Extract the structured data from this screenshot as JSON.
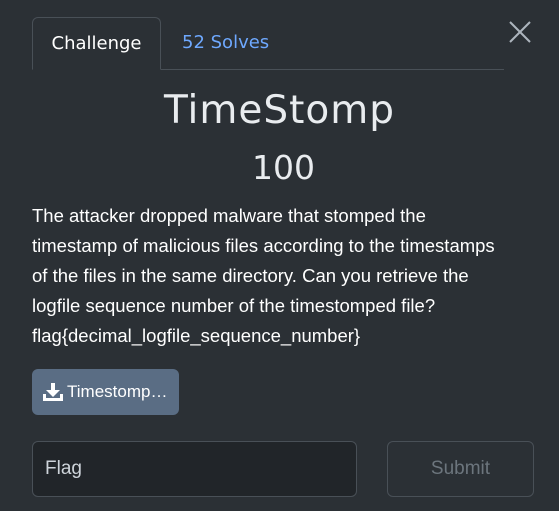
{
  "tabs": [
    {
      "label": "Challenge",
      "active": true
    },
    {
      "label": "52 Solves",
      "active": false
    }
  ],
  "close_icon": "close-icon",
  "challenge": {
    "title": "TimeStomp",
    "points": "100",
    "description_lines": [
      "The attacker dropped malware that stomped the",
      "timestamp of malicious files according to the timestamps",
      "of the files in the same directory. Can you retrieve the",
      "logfile sequence number of the timestomped file?",
      "flag{decimal_logfile_sequence_number}"
    ]
  },
  "download": {
    "icon": "download-icon",
    "label": "Timestomp…"
  },
  "flag_form": {
    "placeholder": "Flag",
    "value": "",
    "submit_label": "Submit"
  },
  "colors": {
    "background": "#2b3035",
    "link": "#6ea8fe",
    "download_button": "#5a6d84",
    "input_background": "#212529",
    "border": "#495057"
  }
}
